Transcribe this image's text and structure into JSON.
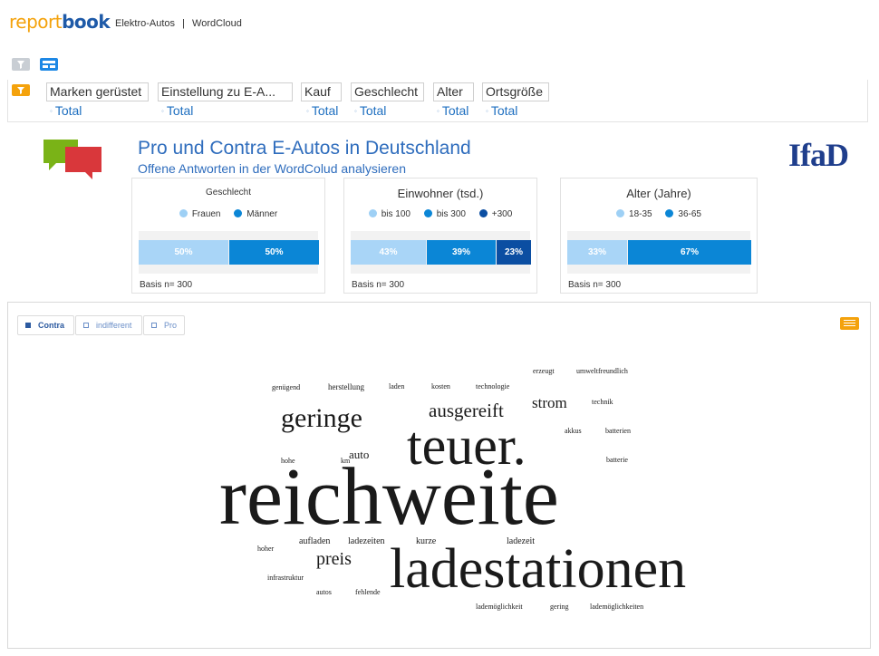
{
  "app": {
    "logo_part1": "report",
    "logo_part2": "book",
    "breadcrumb": [
      "Elektro-Autos",
      "|",
      "WordCloud"
    ]
  },
  "toolbar": {
    "icons": [
      "filter-icon",
      "layout-icon"
    ]
  },
  "filters": [
    {
      "label": "Marken gerüstet",
      "value": "Total"
    },
    {
      "label": "Einstellung zu E-A...",
      "value": "Total"
    },
    {
      "label": "Kauf",
      "value": "Total"
    },
    {
      "label": "Geschlecht",
      "value": "Total"
    },
    {
      "label": "Alter",
      "value": "Total"
    },
    {
      "label": "Ortsgröße",
      "value": "Total"
    }
  ],
  "report": {
    "title": "Pro und Contra E-Autos in Deutschland",
    "subtitle": "Offene Antworten in der WordColud analysieren",
    "brand": "IfaD"
  },
  "kpis": [
    {
      "title": "Geschlecht",
      "legend": [
        {
          "label": "Frauen",
          "color": "#9ed0f5"
        },
        {
          "label": "Männer",
          "color": "#0b86d6"
        }
      ],
      "segments": [
        {
          "label": "50%",
          "value": 50,
          "color": "#a9d5f7"
        },
        {
          "label": "50%",
          "value": 50,
          "color": "#0b86d6"
        }
      ],
      "basis": "Basis n= 300"
    },
    {
      "title": "Einwohner (tsd.)",
      "legend": [
        {
          "label": "bis 100",
          "color": "#9ed0f5"
        },
        {
          "label": "bis 300",
          "color": "#0b86d6"
        },
        {
          "label": "+300",
          "color": "#0b4ea2"
        }
      ],
      "segments": [
        {
          "label": "43%",
          "value": 43,
          "color": "#a9d5f7"
        },
        {
          "label": "39%",
          "value": 39,
          "color": "#0b86d6"
        },
        {
          "label": "23%",
          "value": 18,
          "color": "#0b4ea2"
        }
      ],
      "basis": "Basis n= 300"
    },
    {
      "title": "Alter (Jahre)",
      "legend": [
        {
          "label": "18-35",
          "color": "#9ed0f5"
        },
        {
          "label": "36-65",
          "color": "#0b86d6"
        }
      ],
      "segments": [
        {
          "label": "33%",
          "value": 33,
          "color": "#a9d5f7"
        },
        {
          "label": "67%",
          "value": 67,
          "color": "#0b86d6"
        }
      ],
      "basis": "Basis n= 300"
    }
  ],
  "wordcloud": {
    "tabs": [
      {
        "label": "Contra",
        "active": true
      },
      {
        "label": "indifferent",
        "active": false
      },
      {
        "label": "Pro",
        "active": false
      }
    ],
    "words": [
      "erzeugt",
      "umweltfreundlich",
      "genügend",
      "herstellung",
      "laden",
      "kosten",
      "technologie",
      "technik",
      "geringe",
      "ausgereift",
      "strom",
      "akkus",
      "batterien",
      "teuer.",
      "auto",
      "hohe",
      "km",
      "batterie",
      "reichweite",
      "hoher",
      "aufladen",
      "ladezeiten",
      "kurze",
      "ladezeit",
      "preis",
      "infrastruktur",
      "ladestationen",
      "autos",
      "fehlende",
      "lademöglichkeit",
      "gering",
      "lademöglichkeiten"
    ]
  }
}
